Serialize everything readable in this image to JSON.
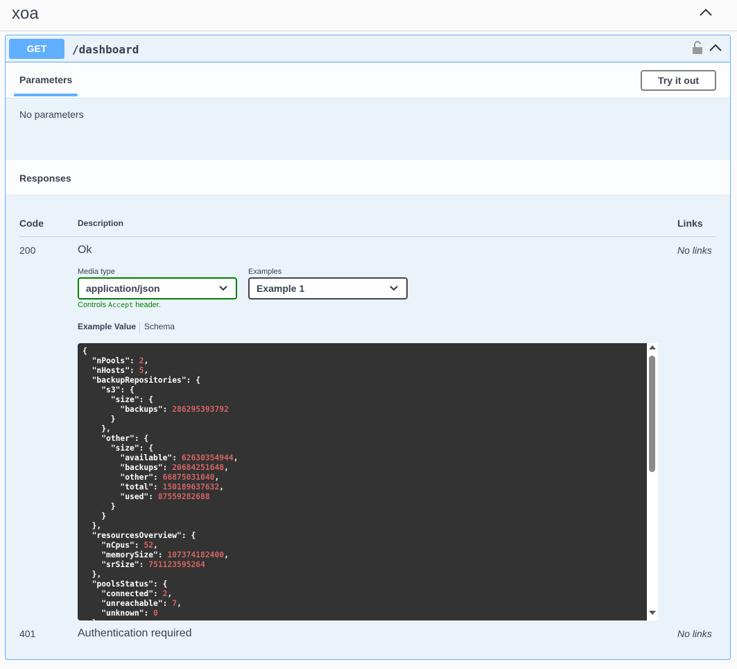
{
  "tag": {
    "title": "xoa"
  },
  "operation": {
    "method": "GET",
    "path": "/dashboard"
  },
  "parameters": {
    "tab_label": "Parameters",
    "try_label": "Try it out",
    "empty_text": "No parameters"
  },
  "responses": {
    "title": "Responses",
    "headers": {
      "code": "Code",
      "description": "Description",
      "links": "Links"
    },
    "rows": [
      {
        "code": "200",
        "description": "Ok",
        "links": "No links",
        "media_type_label": "Media type",
        "media_type_value": "application/json",
        "examples_label": "Examples",
        "examples_value": "Example 1",
        "controls_prefix": "Controls ",
        "controls_code": "Accept",
        "controls_suffix": " header.",
        "tab_example": "Example Value",
        "tab_schema": "Schema"
      },
      {
        "code": "401",
        "description": "Authentication required",
        "links": "No links"
      }
    ]
  },
  "example_json": {
    "nPools": 2,
    "nHosts": 5,
    "backupRepositories": {
      "s3": {
        "size": {
          "backups": 286295393792
        }
      },
      "other": {
        "size": {
          "available": 62630354944,
          "backups": 20684251648,
          "other": 66875031040,
          "total": 150189637632,
          "used": 87559282688
        }
      }
    },
    "resourcesOverview": {
      "nCpus": 52,
      "memorySize": 107374182400,
      "srSize": 751123595264
    },
    "poolsStatus": {
      "connected": 2,
      "unreachable": 7,
      "unknown": 0
    }
  },
  "colors": {
    "get": "#61affe",
    "number": "#d36363",
    "code_bg": "#333333",
    "accept_note": "#008000"
  },
  "icons": {
    "tag_toggle": "chevron-up-icon",
    "lock": "lock-open-icon",
    "collapse": "chevron-up-icon",
    "select": "chevron-down-icon"
  }
}
